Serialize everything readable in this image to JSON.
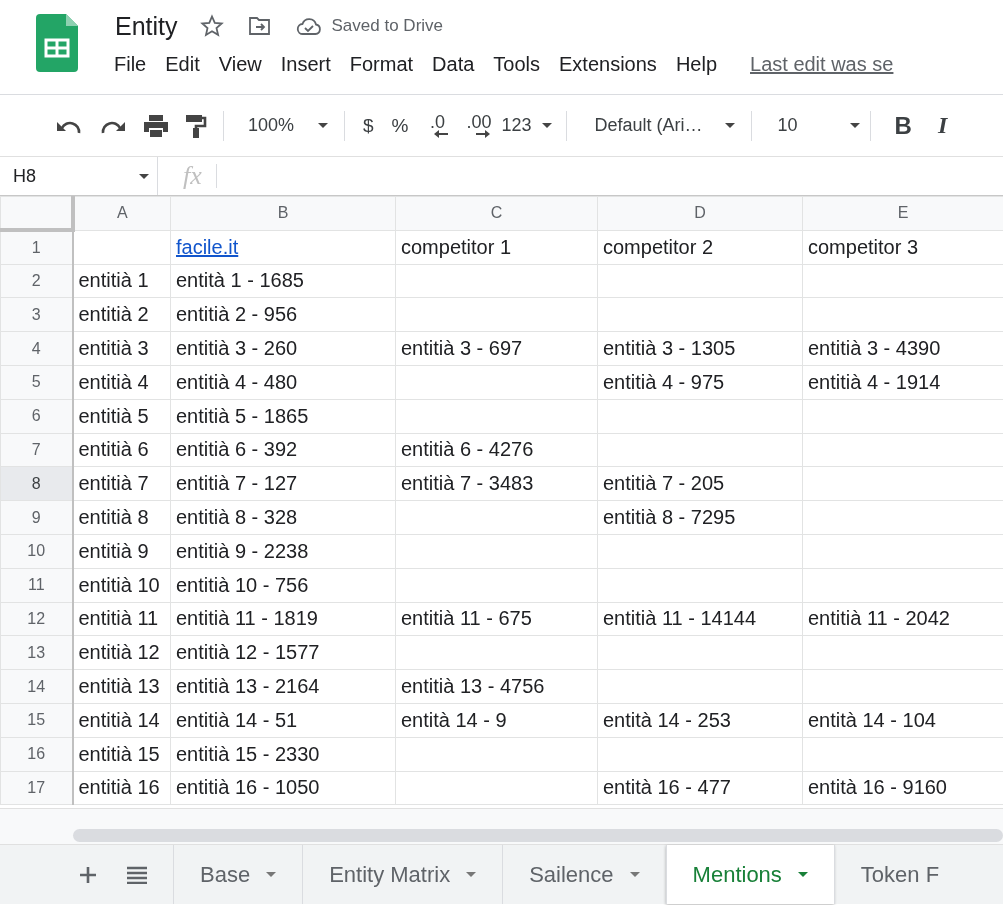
{
  "document": {
    "title": "Entity",
    "save_status": "Saved to Drive"
  },
  "menu": [
    "File",
    "Edit",
    "View",
    "Insert",
    "Format",
    "Data",
    "Tools",
    "Extensions",
    "Help"
  ],
  "last_edit": "Last edit was se",
  "toolbar": {
    "zoom": "100%",
    "currency": "$",
    "percent": "%",
    "decrease_decimals": ".0",
    "increase_decimals": ".00",
    "number_format": "123",
    "font": "Default (Ari…",
    "font_size": "10",
    "bold": "B",
    "italic": "I"
  },
  "formula_bar": {
    "name_box": "H8",
    "fx": "fx"
  },
  "columns": [
    "A",
    "B",
    "C",
    "D",
    "E"
  ],
  "rows": [
    {
      "number": "1",
      "selected": false,
      "cells": [
        {
          "text": ""
        },
        {
          "text": "facile.it",
          "link": true
        },
        {
          "text": "competitor 1"
        },
        {
          "text": "competitor 2"
        },
        {
          "text": "competitor 3"
        }
      ]
    },
    {
      "number": "2",
      "selected": false,
      "cells": [
        {
          "text": "entitià 1"
        },
        {
          "text": "entità 1 - 1685"
        },
        {
          "text": ""
        },
        {
          "text": ""
        },
        {
          "text": ""
        }
      ]
    },
    {
      "number": "3",
      "selected": false,
      "cells": [
        {
          "text": "entitià 2"
        },
        {
          "text": "entitià 2 - 956"
        },
        {
          "text": ""
        },
        {
          "text": ""
        },
        {
          "text": ""
        }
      ]
    },
    {
      "number": "4",
      "selected": false,
      "cells": [
        {
          "text": "entitià 3"
        },
        {
          "text": "entitià 3 - 260"
        },
        {
          "text": "entitià 3 - 697"
        },
        {
          "text": "entitià 3 - 1305"
        },
        {
          "text": "entitià 3 - 4390"
        }
      ]
    },
    {
      "number": "5",
      "selected": false,
      "cells": [
        {
          "text": "entitià 4"
        },
        {
          "text": "entitià 4 - 480"
        },
        {
          "text": ""
        },
        {
          "text": "entitià 4 - 975"
        },
        {
          "text": "entitià 4 - 1914"
        }
      ]
    },
    {
      "number": "6",
      "selected": false,
      "cells": [
        {
          "text": "entitià 5"
        },
        {
          "text": "entitià 5 - 1865"
        },
        {
          "text": ""
        },
        {
          "text": ""
        },
        {
          "text": ""
        }
      ]
    },
    {
      "number": "7",
      "selected": false,
      "cells": [
        {
          "text": "entitià 6"
        },
        {
          "text": "entitià 6 - 392"
        },
        {
          "text": "entitià 6 - 4276"
        },
        {
          "text": ""
        },
        {
          "text": ""
        }
      ]
    },
    {
      "number": "8",
      "selected": true,
      "cells": [
        {
          "text": "entitià 7"
        },
        {
          "text": "entitià 7 - 127"
        },
        {
          "text": "entitià 7 - 3483"
        },
        {
          "text": "entitià 7 - 205"
        },
        {
          "text": ""
        }
      ]
    },
    {
      "number": "9",
      "selected": false,
      "cells": [
        {
          "text": "entitià 8"
        },
        {
          "text": "entitià 8 - 328"
        },
        {
          "text": ""
        },
        {
          "text": "entitià 8 - 7295"
        },
        {
          "text": ""
        }
      ]
    },
    {
      "number": "10",
      "selected": false,
      "cells": [
        {
          "text": "entitià 9"
        },
        {
          "text": "entitià 9 - 2238"
        },
        {
          "text": ""
        },
        {
          "text": ""
        },
        {
          "text": ""
        }
      ]
    },
    {
      "number": "11",
      "selected": false,
      "cells": [
        {
          "text": "entitià 10"
        },
        {
          "text": "entitià 10 - 756"
        },
        {
          "text": ""
        },
        {
          "text": ""
        },
        {
          "text": ""
        }
      ]
    },
    {
      "number": "12",
      "selected": false,
      "cells": [
        {
          "text": "entitià 11"
        },
        {
          "text": "entitià 11 - 1819"
        },
        {
          "text": "entitià 11 - 675"
        },
        {
          "text": "entitià 11 - 14144"
        },
        {
          "text": "entitià 11 - 2042"
        }
      ]
    },
    {
      "number": "13",
      "selected": false,
      "cells": [
        {
          "text": "entitià 12"
        },
        {
          "text": "entitià 12 - 1577"
        },
        {
          "text": ""
        },
        {
          "text": ""
        },
        {
          "text": ""
        }
      ]
    },
    {
      "number": "14",
      "selected": false,
      "cells": [
        {
          "text": "entitià 13"
        },
        {
          "text": "entitià 13 - 2164"
        },
        {
          "text": "entitià 13 - 4756"
        },
        {
          "text": ""
        },
        {
          "text": ""
        }
      ]
    },
    {
      "number": "15",
      "selected": false,
      "cells": [
        {
          "text": "entitià 14"
        },
        {
          "text": "entitià 14 - 51"
        },
        {
          "text": "entità 14 - 9"
        },
        {
          "text": "entità 14 - 253"
        },
        {
          "text": "entità 14 - 104"
        }
      ]
    },
    {
      "number": "16",
      "selected": false,
      "cells": [
        {
          "text": "entitià 15"
        },
        {
          "text": "entitià 15 - 2330"
        },
        {
          "text": ""
        },
        {
          "text": ""
        },
        {
          "text": ""
        }
      ]
    },
    {
      "number": "17",
      "selected": false,
      "cells": [
        {
          "text": "entitià 16"
        },
        {
          "text": "entitià 16 - 1050"
        },
        {
          "text": ""
        },
        {
          "text": "entità 16 - 477"
        },
        {
          "text": "entità 16 - 9160"
        }
      ]
    }
  ],
  "sheet_tabs": [
    {
      "label": "Base",
      "selected": false
    },
    {
      "label": "Entity Matrix",
      "selected": false
    },
    {
      "label": "Sailence",
      "selected": false
    },
    {
      "label": "Mentions",
      "selected": true
    },
    {
      "label": "Token F",
      "selected": false
    }
  ]
}
